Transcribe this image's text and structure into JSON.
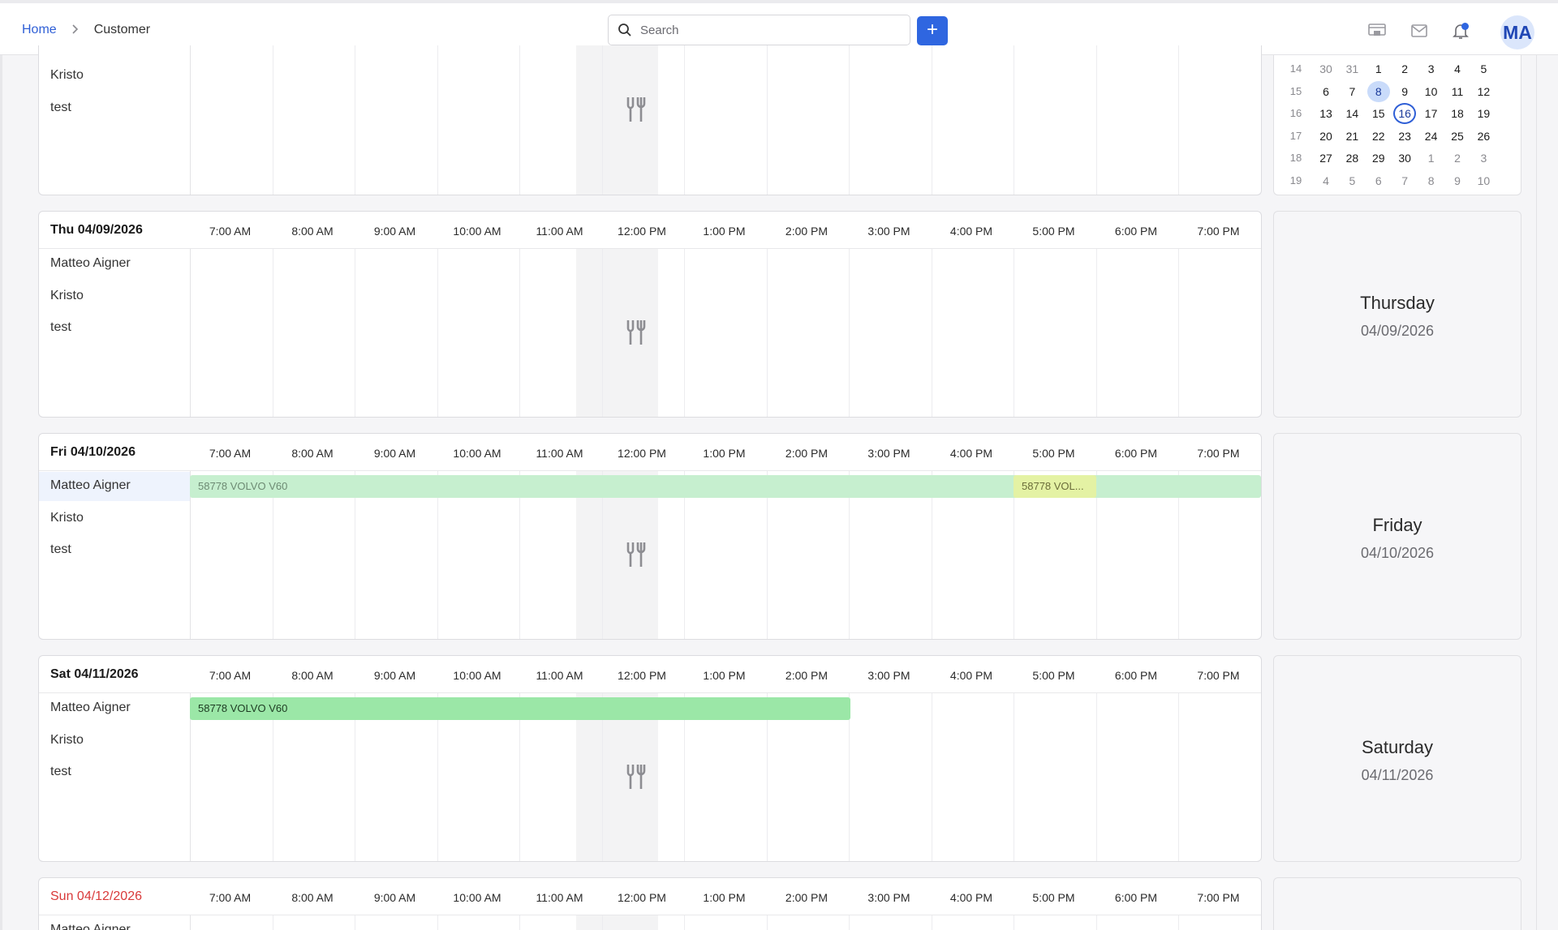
{
  "breadcrumb": {
    "home": "Home",
    "current": "Customer"
  },
  "search": {
    "placeholder": "Search"
  },
  "header": {
    "add_label": "+",
    "avatar_initials": "MA"
  },
  "time_slots": [
    "7:00 AM",
    "8:00 AM",
    "9:00 AM",
    "10:00 AM",
    "11:00 AM",
    "12:00 PM",
    "1:00 PM",
    "2:00 PM",
    "3:00 PM",
    "4:00 PM",
    "5:00 PM",
    "6:00 PM",
    "7:00 PM"
  ],
  "employees": [
    "Matteo Aigner",
    "Kristo",
    "test"
  ],
  "top_partial": {
    "names": [
      "Kristo",
      "test"
    ]
  },
  "days": [
    {
      "label": "Thu 04/09/2026",
      "weekday": "Thursday",
      "date": "04/09/2026"
    },
    {
      "label": "Fri 04/10/2026",
      "weekday": "Friday",
      "date": "04/10/2026",
      "bookings": [
        {
          "text": "58778 VOLVO V60",
          "style": "faded"
        },
        {
          "text": "58778 VOL...",
          "style": "warn"
        }
      ]
    },
    {
      "label": "Sat 04/11/2026",
      "weekday": "Saturday",
      "date": "04/11/2026",
      "bookings": [
        {
          "text": "58778 VOLVO V60",
          "style": "solid"
        }
      ]
    },
    {
      "label": "Sun 04/12/2026",
      "weekday": "",
      "date": "",
      "partial_name": "Matteo Aigner"
    }
  ],
  "mini_calendar": {
    "rows": [
      {
        "week": "14",
        "days": [
          "30",
          "31",
          "1",
          "2",
          "3",
          "4",
          "5"
        ],
        "other": [
          0,
          1
        ]
      },
      {
        "week": "15",
        "days": [
          "6",
          "7",
          "8",
          "9",
          "10",
          "11",
          "12"
        ],
        "selected": 2
      },
      {
        "week": "16",
        "days": [
          "13",
          "14",
          "15",
          "16",
          "17",
          "18",
          "19"
        ],
        "today": 3
      },
      {
        "week": "17",
        "days": [
          "20",
          "21",
          "22",
          "23",
          "24",
          "25",
          "26"
        ]
      },
      {
        "week": "18",
        "days": [
          "27",
          "28",
          "29",
          "30",
          "1",
          "2",
          "3"
        ],
        "other": [
          4,
          5,
          6
        ]
      },
      {
        "week": "19",
        "days": [
          "4",
          "5",
          "6",
          "7",
          "8",
          "9",
          "10"
        ],
        "other": [
          0,
          1,
          2,
          3,
          4,
          5,
          6
        ]
      }
    ]
  },
  "colors": {
    "accent": "#2f66e0",
    "lunch": "#f3f3f4",
    "booking_faded": "#c6efcf",
    "booking_solid": "#9be7a7",
    "booking_warn": "#e4f2a4",
    "sunday": "#d93a3a"
  },
  "icons": {
    "lunch": "fork-knife-icon"
  }
}
